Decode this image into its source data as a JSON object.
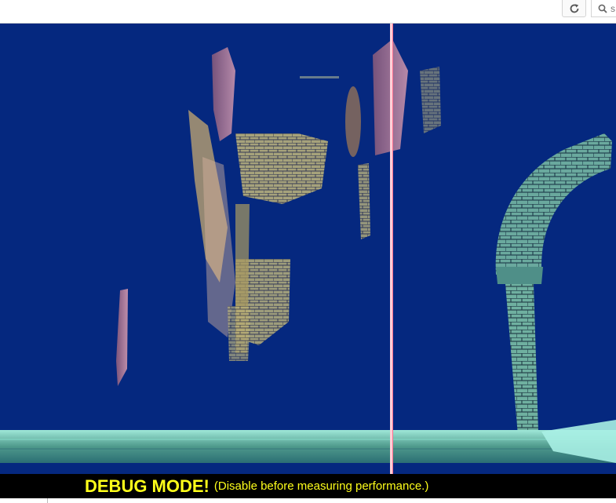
{
  "toolbar": {
    "reload_icon": "reload-icon",
    "search_icon": "search-icon",
    "search_placeholder": "s"
  },
  "debug": {
    "title": "DEBUG MODE!",
    "note": "(Disable before measuring performance.)",
    "color": "#ffff1a"
  },
  "scene": {
    "background_color": "#05287f",
    "floor_color": "#5fb8a8",
    "marker_line_color": "#ff8fa8"
  }
}
